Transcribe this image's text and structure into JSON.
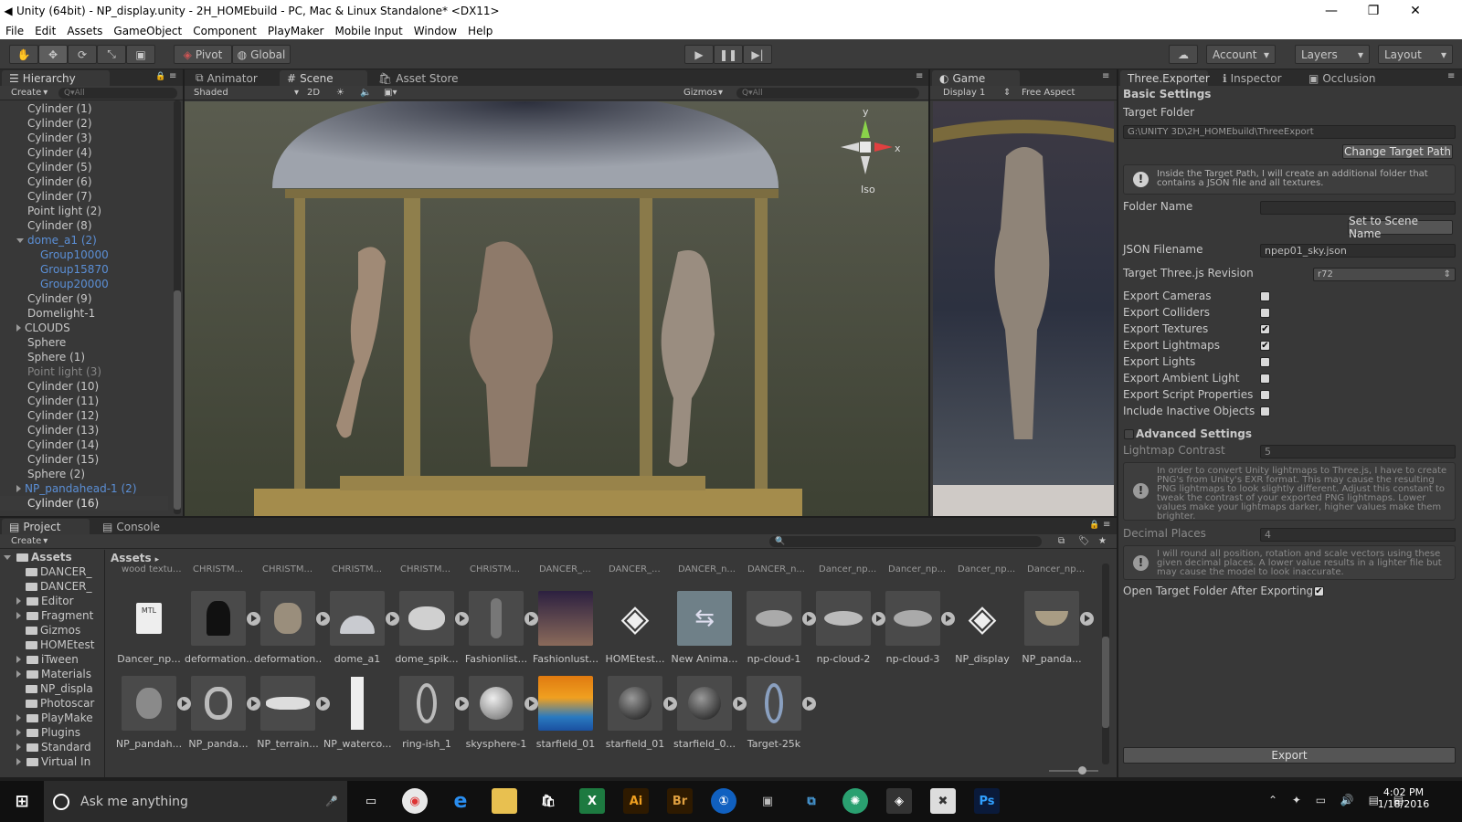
{
  "window": {
    "title": "Unity (64bit) - NP_display.unity - 2H_HOMEbuild - PC, Mac & Linux Standalone* <DX11>"
  },
  "menu": [
    "File",
    "Edit",
    "Assets",
    "GameObject",
    "Component",
    "PlayMaker",
    "Mobile Input",
    "Window",
    "Help"
  ],
  "toolbar": {
    "pivot": "Pivot",
    "global": "Global",
    "account": "Account",
    "layers": "Layers",
    "layout": "Layout"
  },
  "hierarchy": {
    "tab": "Hierarchy",
    "create": "Create",
    "search_placeholder": "Q▾All",
    "items": [
      {
        "label": "Cylinder (1)"
      },
      {
        "label": "Cylinder (2)"
      },
      {
        "label": "Cylinder (3)"
      },
      {
        "label": "Cylinder (4)"
      },
      {
        "label": "Cylinder (5)"
      },
      {
        "label": "Cylinder (6)"
      },
      {
        "label": "Cylinder (7)"
      },
      {
        "label": "Point light (2)"
      },
      {
        "label": "Cylinder (8)"
      },
      {
        "label": "dome_a1 (2)"
      },
      {
        "label": "Group10000"
      },
      {
        "label": "Group15870"
      },
      {
        "label": "Group20000"
      },
      {
        "label": "Cylinder (9)"
      },
      {
        "label": "Domelight-1"
      },
      {
        "label": "CLOUDS"
      },
      {
        "label": "Sphere"
      },
      {
        "label": "Sphere (1)"
      },
      {
        "label": "Point light (3)"
      },
      {
        "label": "Cylinder (10)"
      },
      {
        "label": "Cylinder (11)"
      },
      {
        "label": "Cylinder (12)"
      },
      {
        "label": "Cylinder (13)"
      },
      {
        "label": "Cylinder (14)"
      },
      {
        "label": "Cylinder (15)"
      },
      {
        "label": "Sphere (2)"
      },
      {
        "label": "NP_pandahead-1 (2)"
      },
      {
        "label": "Cylinder (16)"
      }
    ]
  },
  "scene": {
    "tabs": [
      "Animator",
      "Scene",
      "Asset Store"
    ],
    "shading": "Shaded",
    "mode2d": "2D",
    "gizmos": "Gizmos",
    "search_placeholder": "Q▾All",
    "gizmo_iso": "Iso",
    "axis_y": "y",
    "axis_x": "x"
  },
  "game": {
    "tab": "Game",
    "display": "Display 1",
    "aspect": "Free Aspect"
  },
  "inspector": {
    "tabs": [
      "Three.Exporter",
      "Inspector",
      "Occlusion"
    ],
    "basic_settings": "Basic Settings",
    "target_folder_label": "Target Folder",
    "target_folder_value": "G:\\UNITY 3D\\2H_HOMEbuild\\ThreeExport",
    "change_target_button": "Change Target Path",
    "help1": "Inside the Target Path, I will create an additional folder that contains a JSON file and all textures.",
    "folder_name_label": "Folder Name",
    "folder_name_value": "",
    "set_scene_name_button": "Set to Scene Name",
    "json_filename_label": "JSON Filename",
    "json_filename_value": "npep01_sky.json",
    "revision_label": "Target Three.js Revision",
    "revision_value": "r72",
    "options": [
      {
        "label": "Export Cameras",
        "checked": false
      },
      {
        "label": "Export Colliders",
        "checked": false
      },
      {
        "label": "Export Textures",
        "checked": true
      },
      {
        "label": "Export Lightmaps",
        "checked": true
      },
      {
        "label": "Export Lights",
        "checked": false
      },
      {
        "label": "Export Ambient Light",
        "checked": false
      },
      {
        "label": "Export Script Properties",
        "checked": false
      },
      {
        "label": "Include Inactive Objects",
        "checked": false
      }
    ],
    "advanced_settings": "Advanced Settings",
    "lightmap_contrast_label": "Lightmap Contrast",
    "lightmap_contrast_value": "5",
    "help2": "In order to convert Unity lightmaps to Three.js, I have to create PNG's from Unity's EXR format. This may cause the resulting PNG lightmaps to look slightly different. Adjust this constant to tweak the contrast of your exported PNG lightmaps. Lower values make your lightmaps darker, higher values make them brighter.",
    "decimal_places_label": "Decimal Places",
    "decimal_places_value": "4",
    "help3": "I will round all position, rotation and scale vectors using these given decimal places. A lower value results in a lighter file but may cause the model to look inaccurate.",
    "open_target_label": "Open Target Folder After Exporting",
    "open_target_checked": true,
    "export_button": "Export"
  },
  "project": {
    "tabs": [
      "Project",
      "Console"
    ],
    "create": "Create",
    "root": "Assets",
    "folders": [
      "DANCER_",
      "DANCER_",
      "Editor",
      "Fragment",
      "Gizmos",
      "HOMEtest",
      "iTween",
      "Materials",
      "NP_displa",
      "Photoscar",
      "PlayMake",
      "Plugins",
      "Standard",
      "Virtual In"
    ],
    "breadcrumb": "Assets",
    "top_row": [
      "wood textu...",
      "CHRISTM...",
      "CHRISTM...",
      "CHRISTM...",
      "CHRISTM...",
      "CHRISTM...",
      "DANCER_...",
      "DANCER_...",
      "DANCER_n...",
      "DANCER_n...",
      "Dancer_np...",
      "Dancer_np...",
      "Dancer_np...",
      "Dancer_np..."
    ],
    "row1": [
      "Dancer_np...",
      "deformation...",
      "deformation...",
      "dome_a1",
      "dome_spik...",
      "Fashionlist...",
      "Fashionlust...",
      "HOMEtest...",
      "New Anima...",
      "np-cloud-1",
      "np-cloud-2",
      "np-cloud-3",
      "NP_display",
      "NP_panda..."
    ],
    "row2": [
      "NP_pandah...",
      "NP_panda...",
      "NP_terrain...",
      "NP_waterco...",
      "ring-ish_1",
      "skysphere-1",
      "starfield_01",
      "starfield_01",
      "starfield_0...",
      "Target-25k"
    ]
  },
  "taskbar": {
    "search": "Ask me anything",
    "time": "4:02 PM",
    "date": "1/18/2016"
  }
}
